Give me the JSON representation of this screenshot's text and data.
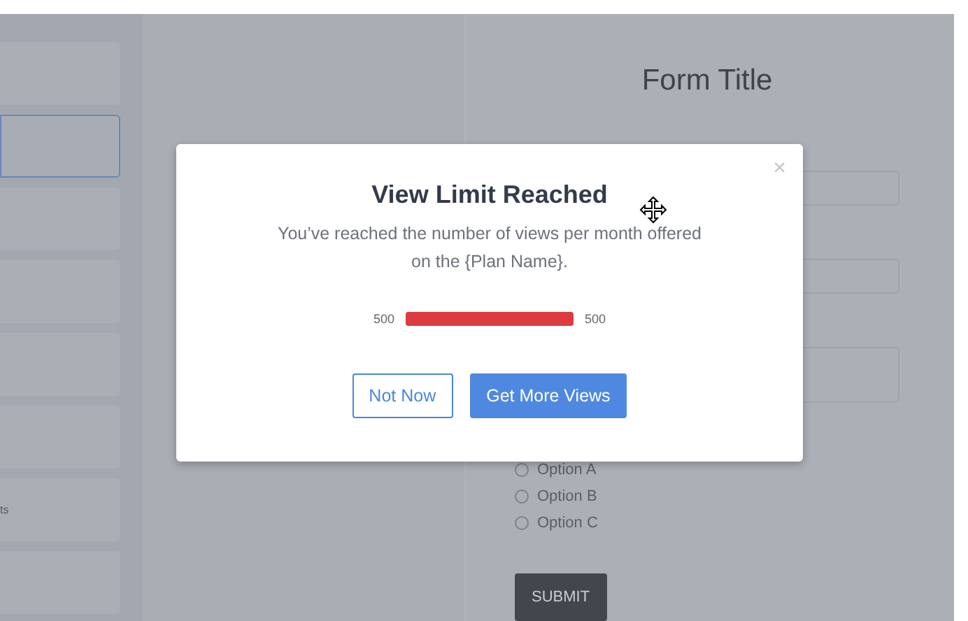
{
  "sidebar": {
    "cards": [
      {
        "selected": false
      },
      {
        "selected": true
      },
      {
        "selected": false
      },
      {
        "selected": false
      },
      {
        "selected": false
      },
      {
        "selected": false
      },
      {
        "selected": false,
        "text": "ts"
      },
      {
        "selected": false
      }
    ]
  },
  "form": {
    "title": "Form Title",
    "fields": [
      {
        "kind": "input"
      },
      {
        "kind": "input"
      },
      {
        "kind": "textarea"
      }
    ],
    "options": [
      {
        "label": "Option A",
        "checked": false
      },
      {
        "label": "Option B",
        "checked": false
      },
      {
        "label": "Option C",
        "checked": false
      }
    ],
    "submit": "SUBMIT"
  },
  "modal": {
    "close": "×",
    "title": "View Limit Reached",
    "message": "You’ve reached the number of views per month offered on the {Plan Name}.",
    "meter": {
      "min_label": "500",
      "max_label": "500"
    },
    "buttons": [
      {
        "label": "Not Now",
        "kind": "secondary"
      },
      {
        "label": "Get More Views",
        "kind": "primary"
      }
    ]
  }
}
